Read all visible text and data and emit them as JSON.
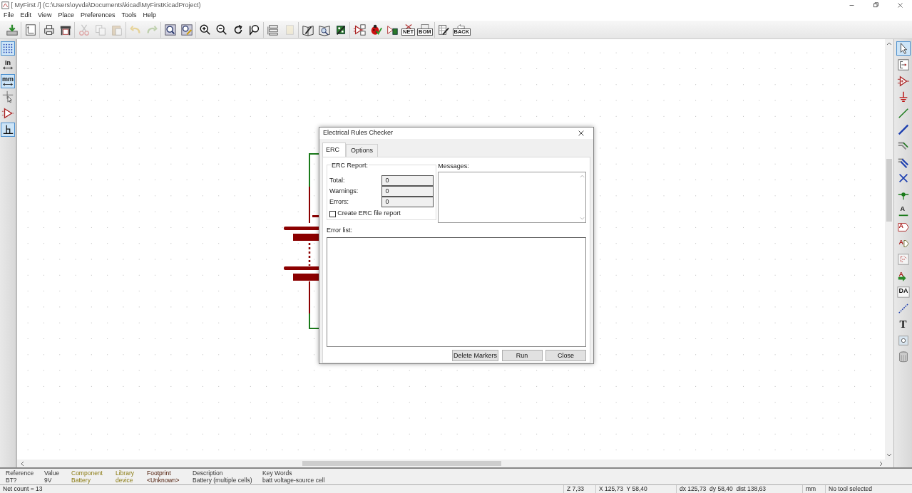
{
  "window": {
    "title": "[ MyFirst /] (C:\\Users\\oyvda\\Documents\\kicad\\MyFirstKicadProject)"
  },
  "menu": [
    "File",
    "Edit",
    "View",
    "Place",
    "Preferences",
    "Tools",
    "Help"
  ],
  "toolbar": {
    "groups": [
      {
        "items": [
          {
            "kind": "save",
            "disabled": false
          }
        ]
      },
      {
        "items": [
          {
            "kind": "page",
            "disabled": false
          }
        ]
      },
      {
        "items": [
          {
            "kind": "print",
            "disabled": false
          },
          {
            "kind": "plot",
            "disabled": false
          }
        ]
      },
      {
        "items": [
          {
            "kind": "cut",
            "disabled": true
          },
          {
            "kind": "copy",
            "disabled": true
          },
          {
            "kind": "paste",
            "disabled": true
          }
        ]
      },
      {
        "items": [
          {
            "kind": "undo",
            "disabled": true
          },
          {
            "kind": "redo",
            "disabled": true
          }
        ]
      },
      {
        "items": [
          {
            "kind": "find",
            "disabled": false
          },
          {
            "kind": "replace",
            "disabled": false
          }
        ]
      },
      {
        "items": [
          {
            "kind": "zoomin",
            "disabled": false
          },
          {
            "kind": "zoomout",
            "disabled": false
          },
          {
            "kind": "redraw",
            "disabled": false
          },
          {
            "kind": "zoomfit",
            "disabled": false
          }
        ]
      },
      {
        "items": [
          {
            "kind": "hierarchy",
            "disabled": false
          },
          {
            "kind": "leave",
            "disabled": true
          }
        ]
      },
      {
        "items": [
          {
            "kind": "libedit",
            "disabled": false
          },
          {
            "kind": "libbrowse",
            "disabled": false
          },
          {
            "kind": "footprint",
            "disabled": false
          }
        ]
      },
      {
        "items": [
          {
            "kind": "annotate",
            "disabled": false
          },
          {
            "kind": "erc",
            "disabled": false
          },
          {
            "kind": "cvpcb",
            "disabled": false
          },
          {
            "kind": "netlist",
            "label": "NET",
            "disabled": false
          },
          {
            "kind": "bom",
            "label": "BOM",
            "disabled": false
          }
        ]
      },
      {
        "items": [
          {
            "kind": "fields",
            "disabled": false
          },
          {
            "kind": "back",
            "label": "BACK",
            "disabled": false
          }
        ]
      }
    ]
  },
  "left_toolbar": [
    {
      "kind": "grid",
      "selected": true
    },
    {
      "kind": "units",
      "label": "In",
      "selected": false
    },
    {
      "kind": "units",
      "label": "mm",
      "selected": true
    },
    {
      "kind": "cursor",
      "selected": false
    },
    {
      "kind": "pins",
      "selected": false
    },
    {
      "kind": "orth",
      "selected": true
    }
  ],
  "right_toolbar": [
    {
      "kind": "select",
      "selected": true
    },
    {
      "kind": "hier",
      "selected": false
    },
    {
      "kind": "component",
      "selected": false
    },
    {
      "kind": "power",
      "selected": false
    },
    {
      "kind": "wire",
      "selected": false
    },
    {
      "kind": "bus",
      "selected": false
    },
    {
      "kind": "wireentry",
      "selected": false
    },
    {
      "kind": "busentry",
      "selected": false
    },
    {
      "kind": "noconn",
      "selected": false
    },
    {
      "kind": "junction",
      "selected": false
    },
    {
      "kind": "netlabel",
      "label": "A",
      "selected": false
    },
    {
      "kind": "globallabel",
      "label": "A",
      "selected": false
    },
    {
      "kind": "hierlabel",
      "label": "A",
      "selected": false
    },
    {
      "kind": "sheetpin",
      "selected": false
    },
    {
      "kind": "importpin",
      "label": "A",
      "selected": false
    },
    {
      "kind": "sheet",
      "label": "DA",
      "selected": false
    },
    {
      "kind": "dashed",
      "selected": false
    },
    {
      "kind": "text",
      "label": "T",
      "selected": false
    },
    {
      "kind": "image",
      "selected": false
    },
    {
      "kind": "delete",
      "selected": false
    }
  ],
  "dialog": {
    "title": "Electrical Rules Checker",
    "tabs": [
      {
        "label": "ERC",
        "selected": true
      },
      {
        "label": "Options",
        "selected": false
      }
    ],
    "report": {
      "legend": "ERC Report:",
      "rows": [
        {
          "label": "Total:",
          "value": "0"
        },
        {
          "label": "Warnings:",
          "value": "0"
        },
        {
          "label": "Errors:",
          "value": "0"
        }
      ],
      "checkbox": {
        "label": "Create ERC file report",
        "checked": false
      }
    },
    "messages_label": "Messages:",
    "error_list_label": "Error list:",
    "buttons": [
      "Delete Markers",
      "Run",
      "Close"
    ]
  },
  "info_panel": [
    {
      "label": "Reference",
      "value": "BT?",
      "kind": "plain"
    },
    {
      "label": "Value",
      "value": "9V",
      "kind": "plain"
    },
    {
      "label": "Component",
      "value": "Battery",
      "kind": "symbol"
    },
    {
      "label": "Library",
      "value": "device",
      "kind": "symbol"
    },
    {
      "label": "Footprint",
      "value": "<Unknown>",
      "kind": "footprint"
    },
    {
      "label": "Description",
      "value": "Battery (multiple cells)",
      "kind": "plain"
    },
    {
      "label": "Key Words",
      "value": "batt voltage-source cell",
      "kind": "plain"
    }
  ],
  "status_bar": [
    "Net count = 13",
    "Z 7,33",
    "X 125,73  Y 58,40",
    "dx 125,73  dy 58,40  dist 138,63",
    "mm",
    "No tool selected"
  ]
}
